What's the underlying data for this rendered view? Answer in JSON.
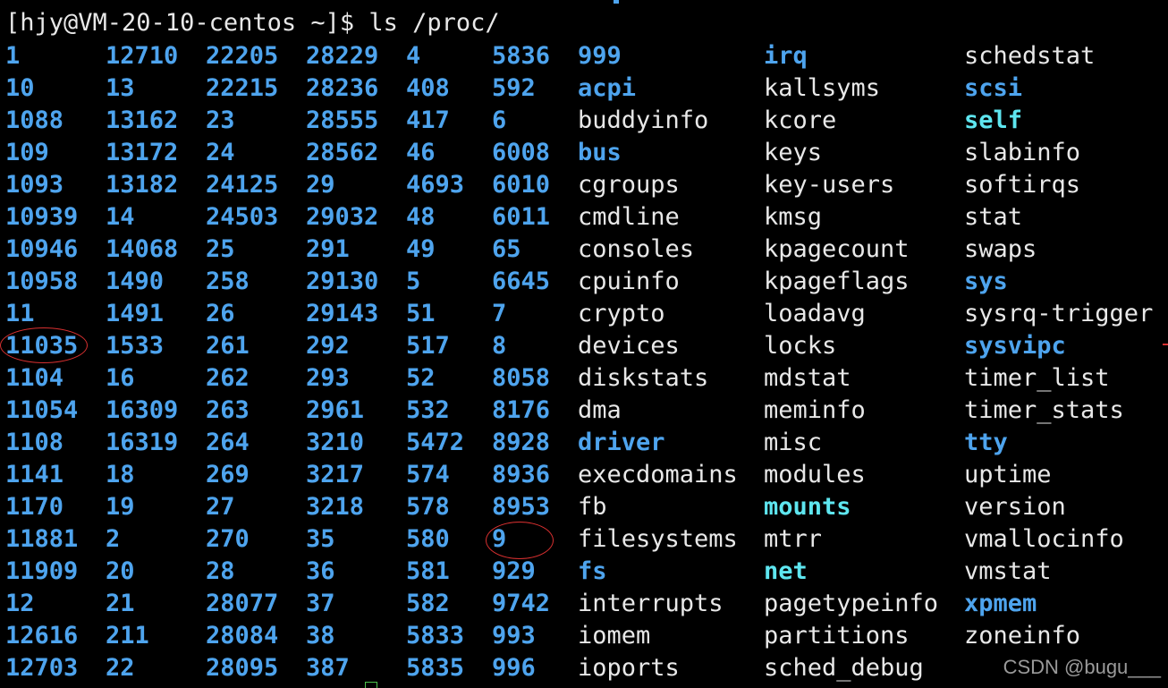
{
  "prompt": "[hjy@VM-20-10-centos ~]$ ls /proc/",
  "columns": [
    {
      "items": [
        {
          "t": "1",
          "k": "num"
        },
        {
          "t": "10",
          "k": "num"
        },
        {
          "t": "1088",
          "k": "num"
        },
        {
          "t": "109",
          "k": "num"
        },
        {
          "t": "1093",
          "k": "num"
        },
        {
          "t": "10939",
          "k": "num"
        },
        {
          "t": "10946",
          "k": "num"
        },
        {
          "t": "10958",
          "k": "num"
        },
        {
          "t": "11",
          "k": "num"
        },
        {
          "t": "11035",
          "k": "num"
        },
        {
          "t": "1104",
          "k": "num"
        },
        {
          "t": "11054",
          "k": "num"
        },
        {
          "t": "1108",
          "k": "num"
        },
        {
          "t": "1141",
          "k": "num"
        },
        {
          "t": "1170",
          "k": "num"
        },
        {
          "t": "11881",
          "k": "num"
        },
        {
          "t": "11909",
          "k": "num"
        },
        {
          "t": "12",
          "k": "num"
        },
        {
          "t": "12616",
          "k": "num"
        },
        {
          "t": "12703",
          "k": "num"
        }
      ]
    },
    {
      "items": [
        {
          "t": "12710",
          "k": "num"
        },
        {
          "t": "13",
          "k": "num"
        },
        {
          "t": "13162",
          "k": "num"
        },
        {
          "t": "13172",
          "k": "num"
        },
        {
          "t": "13182",
          "k": "num"
        },
        {
          "t": "14",
          "k": "num"
        },
        {
          "t": "14068",
          "k": "num"
        },
        {
          "t": "1490",
          "k": "num"
        },
        {
          "t": "1491",
          "k": "num"
        },
        {
          "t": "1533",
          "k": "num"
        },
        {
          "t": "16",
          "k": "num"
        },
        {
          "t": "16309",
          "k": "num"
        },
        {
          "t": "16319",
          "k": "num"
        },
        {
          "t": "18",
          "k": "num"
        },
        {
          "t": "19",
          "k": "num"
        },
        {
          "t": "2",
          "k": "num"
        },
        {
          "t": "20",
          "k": "num"
        },
        {
          "t": "21",
          "k": "num"
        },
        {
          "t": "211",
          "k": "num"
        },
        {
          "t": "22",
          "k": "num"
        }
      ]
    },
    {
      "items": [
        {
          "t": "22205",
          "k": "num"
        },
        {
          "t": "22215",
          "k": "num"
        },
        {
          "t": "23",
          "k": "num"
        },
        {
          "t": "24",
          "k": "num"
        },
        {
          "t": "24125",
          "k": "num"
        },
        {
          "t": "24503",
          "k": "num"
        },
        {
          "t": "25",
          "k": "num"
        },
        {
          "t": "258",
          "k": "num"
        },
        {
          "t": "26",
          "k": "num"
        },
        {
          "t": "261",
          "k": "num"
        },
        {
          "t": "262",
          "k": "num"
        },
        {
          "t": "263",
          "k": "num"
        },
        {
          "t": "264",
          "k": "num"
        },
        {
          "t": "269",
          "k": "num"
        },
        {
          "t": "27",
          "k": "num"
        },
        {
          "t": "270",
          "k": "num"
        },
        {
          "t": "28",
          "k": "num"
        },
        {
          "t": "28077",
          "k": "num"
        },
        {
          "t": "28084",
          "k": "num"
        },
        {
          "t": "28095",
          "k": "num"
        }
      ]
    },
    {
      "items": [
        {
          "t": "28229",
          "k": "num"
        },
        {
          "t": "28236",
          "k": "num"
        },
        {
          "t": "28555",
          "k": "num"
        },
        {
          "t": "28562",
          "k": "num"
        },
        {
          "t": "29",
          "k": "num"
        },
        {
          "t": "29032",
          "k": "num"
        },
        {
          "t": "291",
          "k": "num"
        },
        {
          "t": "29130",
          "k": "num"
        },
        {
          "t": "29143",
          "k": "num"
        },
        {
          "t": "292",
          "k": "num"
        },
        {
          "t": "293",
          "k": "num"
        },
        {
          "t": "2961",
          "k": "num"
        },
        {
          "t": "3210",
          "k": "num"
        },
        {
          "t": "3217",
          "k": "num"
        },
        {
          "t": "3218",
          "k": "num"
        },
        {
          "t": "35",
          "k": "num"
        },
        {
          "t": "36",
          "k": "num"
        },
        {
          "t": "37",
          "k": "num"
        },
        {
          "t": "38",
          "k": "num"
        },
        {
          "t": "387",
          "k": "num"
        }
      ]
    },
    {
      "items": [
        {
          "t": "4",
          "k": "num"
        },
        {
          "t": "408",
          "k": "num"
        },
        {
          "t": "417",
          "k": "num"
        },
        {
          "t": "46",
          "k": "num"
        },
        {
          "t": "4693",
          "k": "num"
        },
        {
          "t": "48",
          "k": "num"
        },
        {
          "t": "49",
          "k": "num"
        },
        {
          "t": "5",
          "k": "num"
        },
        {
          "t": "51",
          "k": "num"
        },
        {
          "t": "517",
          "k": "num"
        },
        {
          "t": "52",
          "k": "num"
        },
        {
          "t": "532",
          "k": "num"
        },
        {
          "t": "5472",
          "k": "num"
        },
        {
          "t": "574",
          "k": "num"
        },
        {
          "t": "578",
          "k": "num"
        },
        {
          "t": "580",
          "k": "num"
        },
        {
          "t": "581",
          "k": "num"
        },
        {
          "t": "582",
          "k": "num"
        },
        {
          "t": "5833",
          "k": "num"
        },
        {
          "t": "5835",
          "k": "num"
        }
      ]
    },
    {
      "items": [
        {
          "t": "5836",
          "k": "num"
        },
        {
          "t": "592",
          "k": "num"
        },
        {
          "t": "6",
          "k": "num"
        },
        {
          "t": "6008",
          "k": "num"
        },
        {
          "t": "6010",
          "k": "num"
        },
        {
          "t": "6011",
          "k": "num"
        },
        {
          "t": "65",
          "k": "num"
        },
        {
          "t": "6645",
          "k": "num"
        },
        {
          "t": "7",
          "k": "num"
        },
        {
          "t": "8",
          "k": "num"
        },
        {
          "t": "8058",
          "k": "num"
        },
        {
          "t": "8176",
          "k": "num"
        },
        {
          "t": "8928",
          "k": "num"
        },
        {
          "t": "8936",
          "k": "num"
        },
        {
          "t": "8953",
          "k": "num"
        },
        {
          "t": "9",
          "k": "num"
        },
        {
          "t": "929",
          "k": "num"
        },
        {
          "t": "9742",
          "k": "num"
        },
        {
          "t": "993",
          "k": "num"
        },
        {
          "t": "996",
          "k": "num"
        }
      ]
    },
    {
      "items": [
        {
          "t": "999",
          "k": "num"
        },
        {
          "t": "acpi",
          "k": "dir"
        },
        {
          "t": "buddyinfo",
          "k": "file"
        },
        {
          "t": "bus",
          "k": "dir"
        },
        {
          "t": "cgroups",
          "k": "file"
        },
        {
          "t": "cmdline",
          "k": "file"
        },
        {
          "t": "consoles",
          "k": "file"
        },
        {
          "t": "cpuinfo",
          "k": "file"
        },
        {
          "t": "crypto",
          "k": "file"
        },
        {
          "t": "devices",
          "k": "file"
        },
        {
          "t": "diskstats",
          "k": "file"
        },
        {
          "t": "dma",
          "k": "file"
        },
        {
          "t": "driver",
          "k": "dir"
        },
        {
          "t": "execdomains",
          "k": "file"
        },
        {
          "t": "fb",
          "k": "file"
        },
        {
          "t": "filesystems",
          "k": "file"
        },
        {
          "t": "fs",
          "k": "dir"
        },
        {
          "t": "interrupts",
          "k": "file"
        },
        {
          "t": "iomem",
          "k": "file"
        },
        {
          "t": "ioports",
          "k": "file"
        }
      ]
    },
    {
      "items": [
        {
          "t": "irq",
          "k": "dir"
        },
        {
          "t": "kallsyms",
          "k": "file"
        },
        {
          "t": "kcore",
          "k": "file"
        },
        {
          "t": "keys",
          "k": "file"
        },
        {
          "t": "key-users",
          "k": "file"
        },
        {
          "t": "kmsg",
          "k": "file"
        },
        {
          "t": "kpagecount",
          "k": "file"
        },
        {
          "t": "kpageflags",
          "k": "file"
        },
        {
          "t": "loadavg",
          "k": "file"
        },
        {
          "t": "locks",
          "k": "file"
        },
        {
          "t": "mdstat",
          "k": "file"
        },
        {
          "t": "meminfo",
          "k": "file"
        },
        {
          "t": "misc",
          "k": "file"
        },
        {
          "t": "modules",
          "k": "file"
        },
        {
          "t": "mounts",
          "k": "link"
        },
        {
          "t": "mtrr",
          "k": "file"
        },
        {
          "t": "net",
          "k": "link"
        },
        {
          "t": "pagetypeinfo",
          "k": "file"
        },
        {
          "t": "partitions",
          "k": "file"
        },
        {
          "t": "sched_debug",
          "k": "file"
        }
      ]
    },
    {
      "items": [
        {
          "t": "schedstat",
          "k": "file"
        },
        {
          "t": "scsi",
          "k": "dir"
        },
        {
          "t": "self",
          "k": "link"
        },
        {
          "t": "slabinfo",
          "k": "file"
        },
        {
          "t": "softirqs",
          "k": "file"
        },
        {
          "t": "stat",
          "k": "file"
        },
        {
          "t": "swaps",
          "k": "file"
        },
        {
          "t": "sys",
          "k": "dir"
        },
        {
          "t": "sysrq-trigger",
          "k": "file"
        },
        {
          "t": "sysvipc",
          "k": "dir"
        },
        {
          "t": "timer_list",
          "k": "file"
        },
        {
          "t": "timer_stats",
          "k": "file"
        },
        {
          "t": "tty",
          "k": "dir"
        },
        {
          "t": "uptime",
          "k": "file"
        },
        {
          "t": "version",
          "k": "file"
        },
        {
          "t": "vmallocinfo",
          "k": "file"
        },
        {
          "t": "vmstat",
          "k": "file"
        },
        {
          "t": "xpmem",
          "k": "dir"
        },
        {
          "t": "zoneinfo",
          "k": "file"
        }
      ]
    }
  ],
  "annotations": [
    {
      "label": "11035",
      "shape": "ellipse",
      "color": "#d83030"
    },
    {
      "label": "9",
      "shape": "ellipse",
      "color": "#d83030"
    }
  ],
  "watermark": "CSDN @bugu___",
  "colors": {
    "background": "#000000",
    "number_entry": "#4ea4ee",
    "directory": "#4ea4ee",
    "regular_file": "#e8e8e8",
    "symlink": "#5ee6f0",
    "annotation": "#d83030"
  }
}
